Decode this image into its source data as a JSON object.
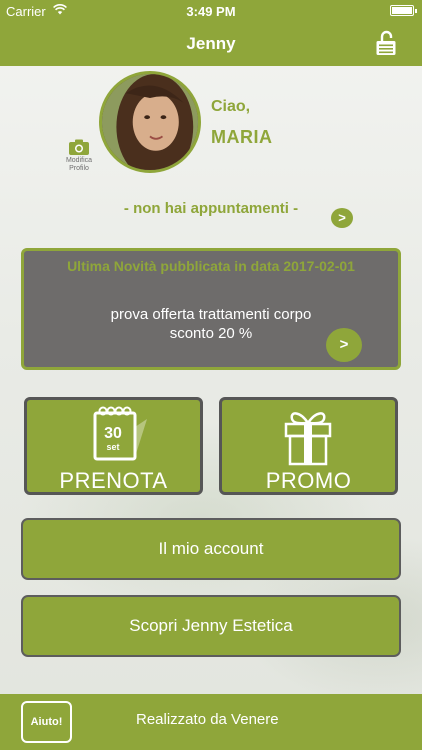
{
  "status_bar": {
    "carrier": "Carrier",
    "time": "3:49 PM"
  },
  "nav": {
    "title": "Jenny",
    "lock_icon": "lock-open-icon"
  },
  "profile": {
    "greeting": "Ciao,",
    "name": "MARIA",
    "edit_photo_label": "Modifica Profilo",
    "camera_icon": "camera-icon"
  },
  "appointments": {
    "status": "- non hai appuntamenti -",
    "arrow": ">"
  },
  "news": {
    "title": "Ultima Novità pubblicata in data 2017-02-01",
    "line1": "prova offerta trattamenti corpo",
    "line2": "sconto 20 %",
    "arrow": ">"
  },
  "tiles": {
    "prenota": {
      "label": "PRENOTA",
      "calendar_day": "30",
      "calendar_month": "set"
    },
    "promo": {
      "label": "PROMO"
    }
  },
  "buttons": {
    "account": "Il mio account",
    "scopri": "Scopri Jenny Estetica"
  },
  "footer": {
    "help": "Aiuto!",
    "credit": "Realizzato da Venere"
  },
  "colors": {
    "accent": "#8fa63a",
    "card_gray": "#6e6c6b",
    "border_dark": "#565656"
  }
}
